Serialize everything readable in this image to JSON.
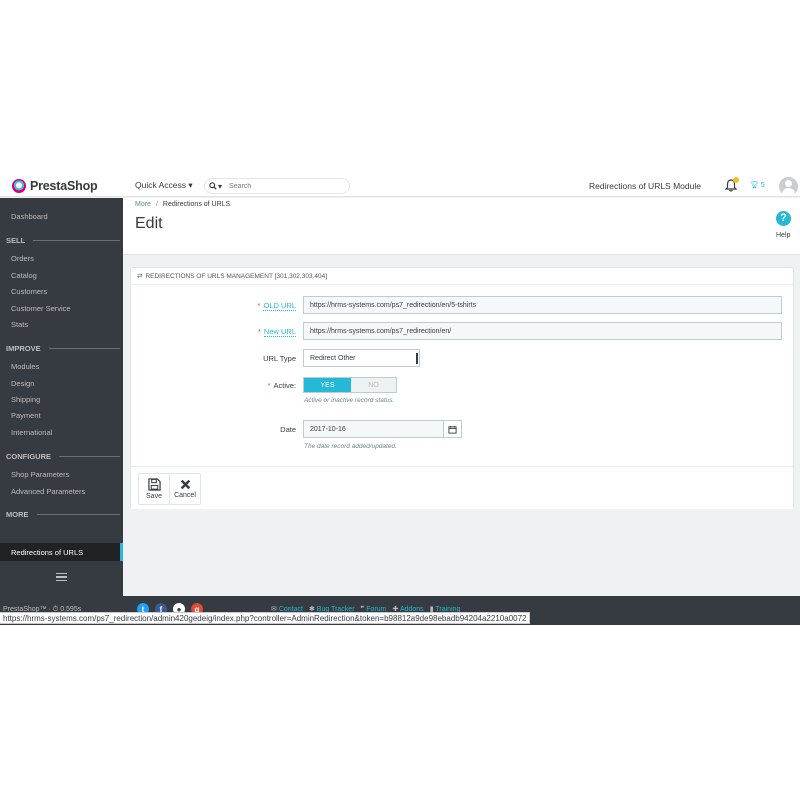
{
  "app": {
    "logo_text": "PrestaShop"
  },
  "header": {
    "quick_access_label": "Quick Access",
    "search_placeholder": "Search",
    "shop_name": "Redirections of URLS Module",
    "trophy_count": "5"
  },
  "sidebar": {
    "dashboard": "Dashboard",
    "sections": [
      {
        "title": "SELL",
        "items": [
          "Orders",
          "Catalog",
          "Customers",
          "Customer Service",
          "Stats"
        ]
      },
      {
        "title": "IMPROVE",
        "items": [
          "Modules",
          "Design",
          "Shipping",
          "Payment",
          "International"
        ]
      },
      {
        "title": "CONFIGURE",
        "items": [
          "Shop Parameters",
          "Advanced Parameters"
        ]
      },
      {
        "title": "MORE",
        "items": [
          "Redirections of URLS"
        ]
      }
    ],
    "active_item": "Redirections of URLS"
  },
  "page": {
    "breadcrumb": [
      "More",
      "Redirections of URLS"
    ],
    "title": "Edit",
    "help_label": "Help"
  },
  "panel": {
    "heading": "REDIRECTIONS OF URLS MANAGEMENT [301,302,303,404]",
    "fields": {
      "old_url_label": "OLD URL",
      "old_url_value": "https://hrms-systems.com/ps7_redirection/en/5-tshirts",
      "new_url_label": "New URL",
      "new_url_value": "https://hrms-systems.com/ps7_redirection/en/",
      "url_type_label": "URL Type",
      "url_type_value": "Redirect Other",
      "active_label": "Active:",
      "active_yes": "YES",
      "active_no": "NO",
      "active_help": "Active or inactive record status.",
      "date_label": "Date",
      "date_value": "2017-10-16",
      "date_help": "The date record added/updated."
    },
    "footer": {
      "save_label": "Save",
      "cancel_label": "Cancel"
    }
  },
  "bottom_bar": {
    "version_text": "PrestaShop™ · ⏱ 0.595s",
    "links": [
      "Contact",
      "Bug Tracker",
      "Forum",
      "Addons",
      "Training"
    ]
  },
  "status_url": "https://hrms-systems.com/ps7_redirection/admin420gedeig/index.php?controller=AdminRedirection&token=b98812a9de98ebadb94204a2210a0072",
  "colors": {
    "accent": "#25b9d7",
    "sidebar": "#363a41",
    "required": "#c05c67",
    "brand_pink": "#df0067"
  }
}
